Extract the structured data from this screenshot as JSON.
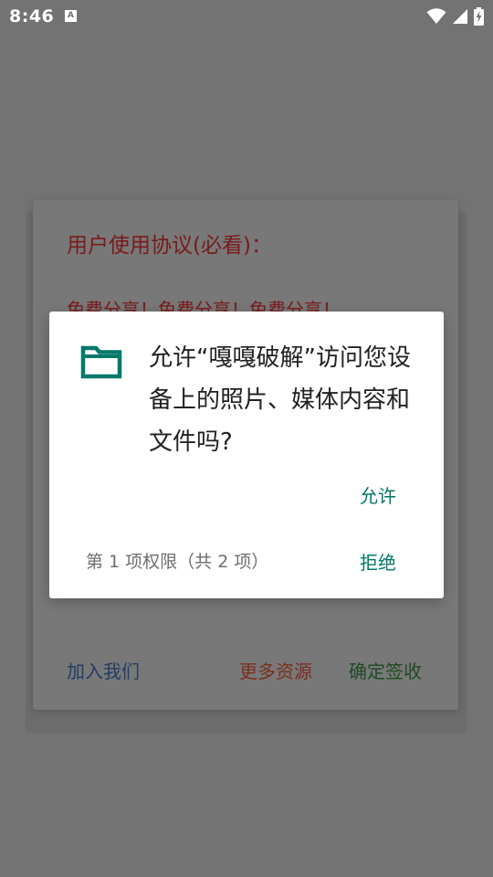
{
  "status_bar": {
    "time": "8:46",
    "notification_glyph": "A",
    "icons": [
      "wifi-icon",
      "signal-icon",
      "battery-charging-icon"
    ]
  },
  "background_dialog": {
    "title": "用户使用协议(必看)：",
    "body_line": "免费分享！免费分享！免费分享！",
    "actions": {
      "join": "加入我们",
      "more_resources": "更多资源",
      "confirm_sign": "确定签收"
    },
    "colors": {
      "title": "#7a1a1a",
      "join": "#1f3d66",
      "more": "#7a2e1e",
      "sign": "#1f4a24"
    }
  },
  "permission_dialog": {
    "icon": "folder-icon",
    "message": "允许“嘎嘎破解”访问您设备上的照片、媒体内容和文件吗?",
    "allow_label": "允许",
    "deny_label": "拒绝",
    "counter": "第 1 项权限（共 2 项）",
    "accent_color": "#00796b"
  }
}
